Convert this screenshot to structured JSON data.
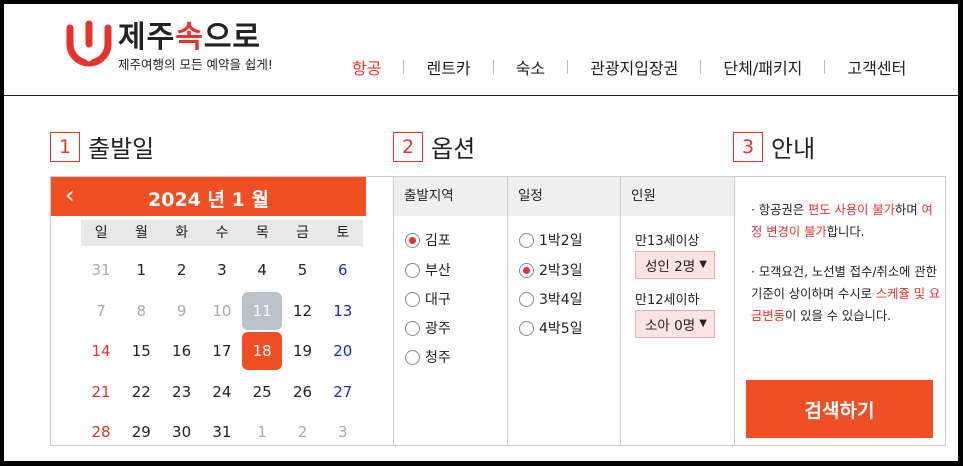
{
  "brand": {
    "name_prefix": "제주",
    "name_accent": "속",
    "name_suffix": "으로",
    "slogan": "제주여행의 모든 예약을 쉽게!"
  },
  "nav": {
    "items": [
      "항공",
      "렌트카",
      "숙소",
      "관광지입장권",
      "단체/패키지",
      "고객센터"
    ],
    "active_index": 0
  },
  "sections": [
    {
      "num": "1",
      "title": "출발일"
    },
    {
      "num": "2",
      "title": "옵션"
    },
    {
      "num": "3",
      "title": "안내"
    }
  ],
  "calendar": {
    "title": "2024 년 1 월",
    "prev_icon": "‹",
    "next_icon": "›",
    "weekdays": [
      "일",
      "월",
      "화",
      "수",
      "목",
      "금",
      "토"
    ],
    "weeks": [
      [
        "31",
        "1",
        "2",
        "3",
        "4",
        "5",
        "6"
      ],
      [
        "7",
        "8",
        "9",
        "10",
        "11",
        "12",
        "13"
      ],
      [
        "14",
        "15",
        "16",
        "17",
        "18",
        "19",
        "20"
      ],
      [
        "21",
        "22",
        "23",
        "24",
        "25",
        "26",
        "27"
      ],
      [
        "28",
        "29",
        "30",
        "31",
        "1",
        "2",
        "3"
      ]
    ],
    "today": "11",
    "selected": "18"
  },
  "options": {
    "departure": {
      "header": "출발지역",
      "items": [
        "김포",
        "부산",
        "대구",
        "광주",
        "청주"
      ],
      "selected_index": 0
    },
    "duration": {
      "header": "일정",
      "items": [
        "1박2일",
        "2박3일",
        "3박4일",
        "4박5일"
      ],
      "selected_index": 1
    },
    "people": {
      "header": "인원",
      "adult_label": "만13세이상",
      "adult_value": "성인 2명",
      "child_label": "만12세이하",
      "child_value": "소아 0명",
      "caret": "▼"
    }
  },
  "info": {
    "p1": {
      "a": "· 항공권은 ",
      "b": "편도 사용이 불가",
      "c": "하며 ",
      "d": "여정 변경이 불가",
      "e": "합니다."
    },
    "p2": {
      "a": "· 모객요건, 노선별 접수/취소에 관한 기준이 상이하며 수시로 ",
      "b": "스케쥴 및 요금변동",
      "c": "이 있을 수 있습니다."
    }
  },
  "search_button": "검색하기",
  "colors": {
    "accent": "#f04e23",
    "brand_red": "#e8322c",
    "saturday": "#1b2fbd",
    "today_bg": "#b8c3cc"
  }
}
